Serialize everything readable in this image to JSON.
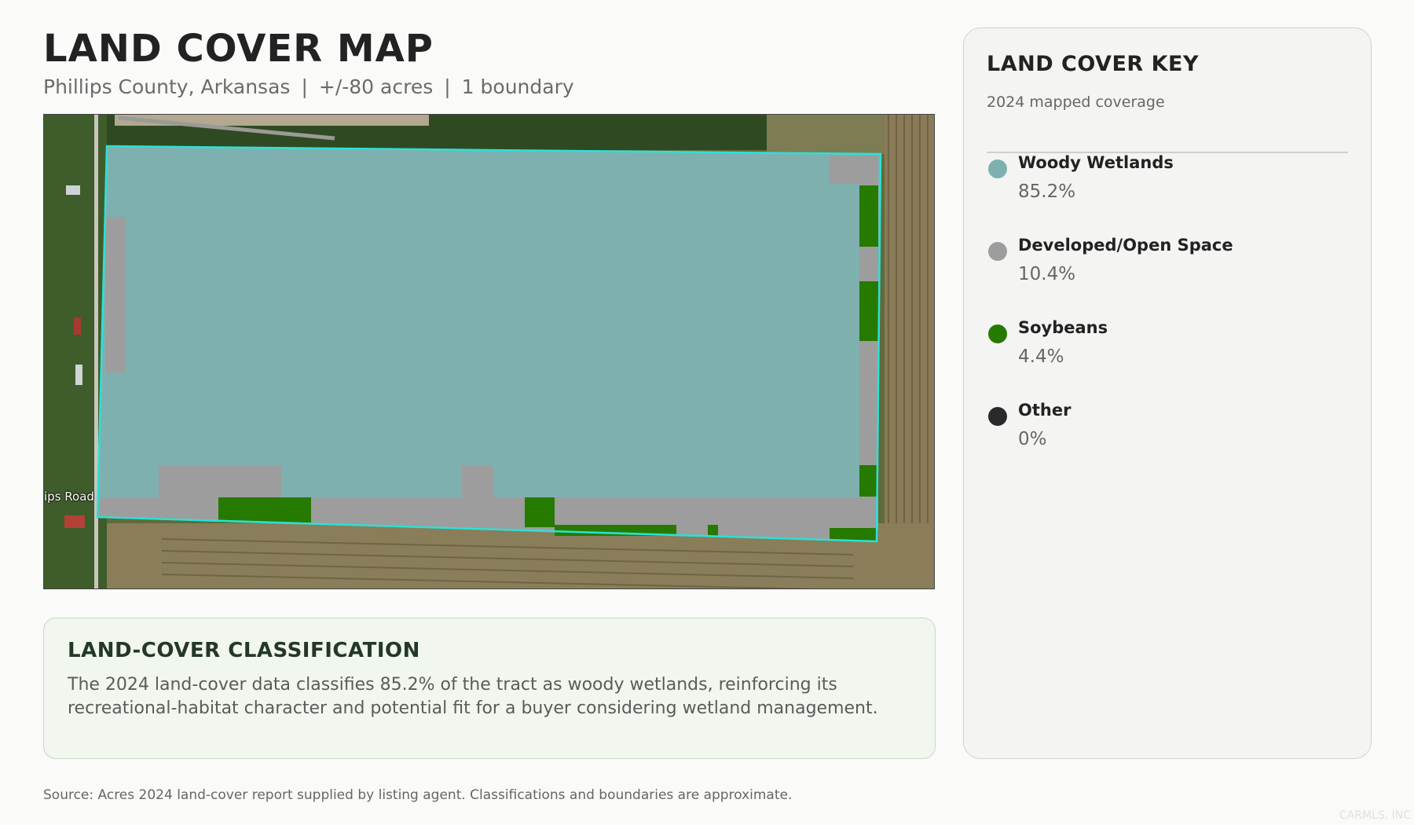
{
  "header": {
    "title": "LAND COVER MAP",
    "location": "Phillips County, Arkansas",
    "acreage": "+/-80 acres",
    "boundaries": "1 boundary"
  },
  "map": {
    "road_label": "ips Road",
    "boundary_color": "#2de0d6"
  },
  "classification_note": {
    "heading": "LAND-COVER CLASSIFICATION",
    "body": "The 2024 land-cover data classifies 85.2% of the tract as woody wetlands, reinforcing its recreational-habitat character and potential fit for a buyer considering wetland management."
  },
  "key": {
    "title": "LAND COVER KEY",
    "subtitle": "2024 mapped coverage",
    "items": [
      {
        "label": "Woody Wetlands",
        "percent": "85.2%",
        "color": "#7fb0b0"
      },
      {
        "label": "Developed/Open Space",
        "percent": "10.4%",
        "color": "#9d9d9d"
      },
      {
        "label": "Soybeans",
        "percent": "4.4%",
        "color": "#267a00"
      },
      {
        "label": "Other",
        "percent": "0%",
        "color": "#2a2a2a"
      }
    ]
  },
  "footer": {
    "source": "Source: Acres 2024 land-cover report supplied by listing agent. Classifications and boundaries are approximate.",
    "watermark": "CARMLS, INC"
  }
}
